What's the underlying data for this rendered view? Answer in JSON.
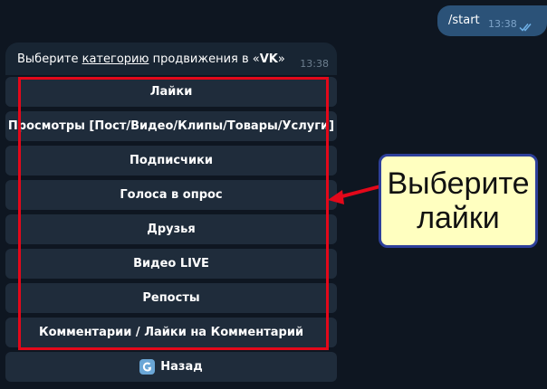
{
  "outgoing": {
    "text": "/start",
    "time": "13:38"
  },
  "incoming": {
    "text_before": "Выберите ",
    "text_underlined": "категорию",
    "text_middle": " продвижения в «",
    "text_bold": "VK",
    "text_after": "»",
    "time": "13:38"
  },
  "keyboard": {
    "buttons": [
      "Лайки",
      "Просмотры [Пост/Видео/Клипы/Товары/Услуги]",
      "Подписчики",
      "Голоса в опрос",
      "Друзья",
      "Видео LIVE",
      "Репосты",
      "Комментарии / Лайки на Комментарий"
    ],
    "back_label": "Назад"
  },
  "callout": {
    "line1": "Выберите",
    "line2": "лайки"
  },
  "colors": {
    "background": "#0e1621",
    "outgoing_bubble": "#2b5278",
    "incoming_bubble": "#182533",
    "keyboard_button": "#1f2c3b",
    "highlight": "#e3081a",
    "callout_bg": "#ffffc0",
    "callout_border": "#2d3f9a"
  },
  "icons": {
    "ticks": "double-check-icon",
    "back": "back-arrow-icon",
    "pointer": "red-arrow-icon"
  }
}
